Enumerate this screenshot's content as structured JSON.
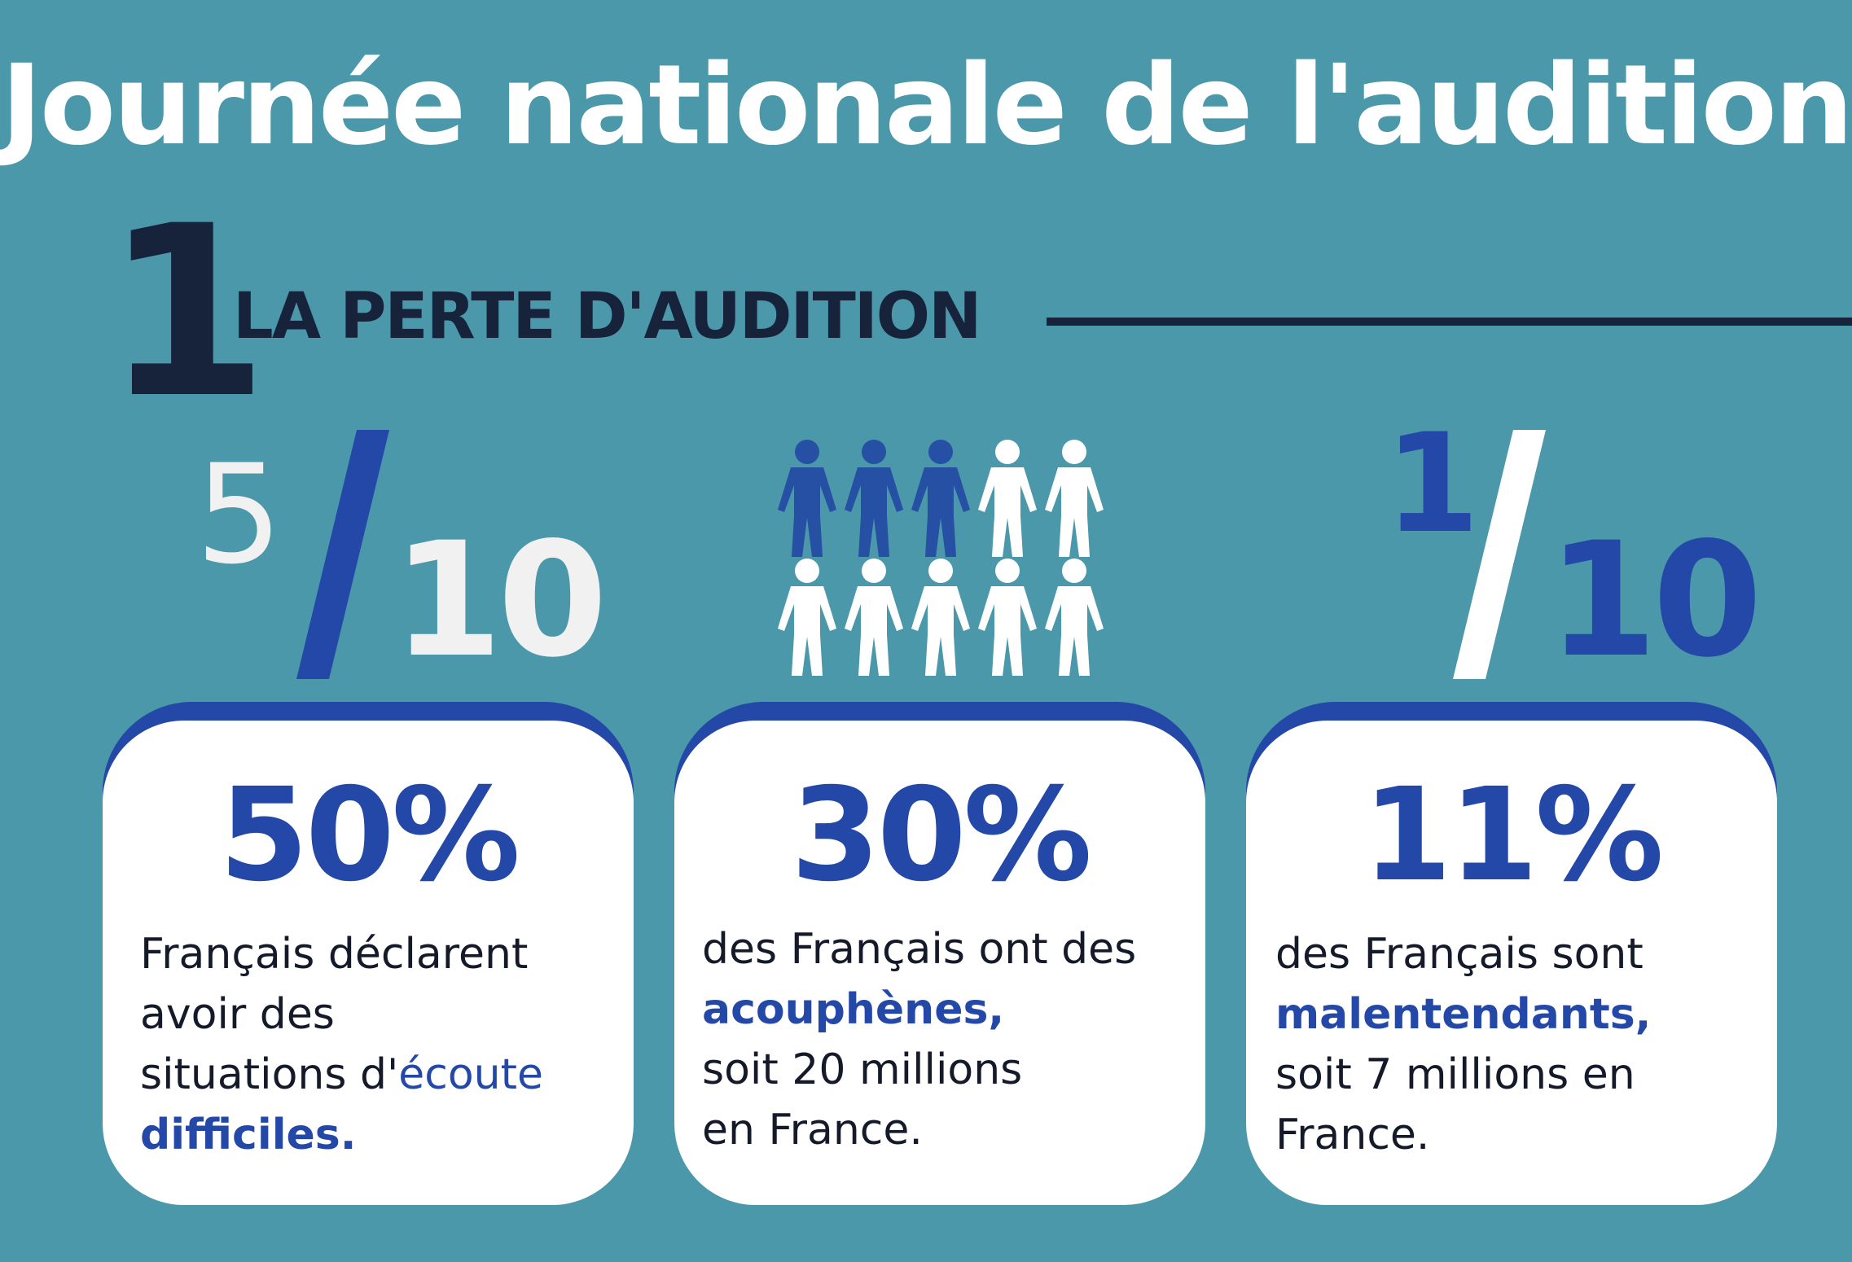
{
  "header": {
    "title": "Journée nationale de l'audition",
    "section_number": "1",
    "section_title": "LA PERTE D'AUDITION"
  },
  "fractions": [
    {
      "numerator": "5",
      "denominator": "10"
    },
    {
      "numerator": "1",
      "denominator": "10"
    }
  ],
  "pictogram": {
    "total": 10,
    "highlighted": 3,
    "icon": "person-icon"
  },
  "cards": [
    {
      "percent": "50%",
      "lines": [
        "Français déclarent",
        "avoir des",
        "situations d'"
      ],
      "highlight_1": "écoute",
      "highlight_2": "difficiles."
    },
    {
      "percent": "30%",
      "line_1": "des Français ont des",
      "highlight": "acouphènes,",
      "line_3": "soit 20 millions",
      "line_4": "en France."
    },
    {
      "percent": "11%",
      "line_1": "des Français sont",
      "highlight": "malentendants,",
      "line_3": "soit 7 millions en",
      "line_4": "France."
    }
  ],
  "colors": {
    "background": "#4b98ab",
    "accent_blue": "#2348a8",
    "dark_navy": "#17223b",
    "person_blue": "#2550a3",
    "white": "#ffffff"
  }
}
